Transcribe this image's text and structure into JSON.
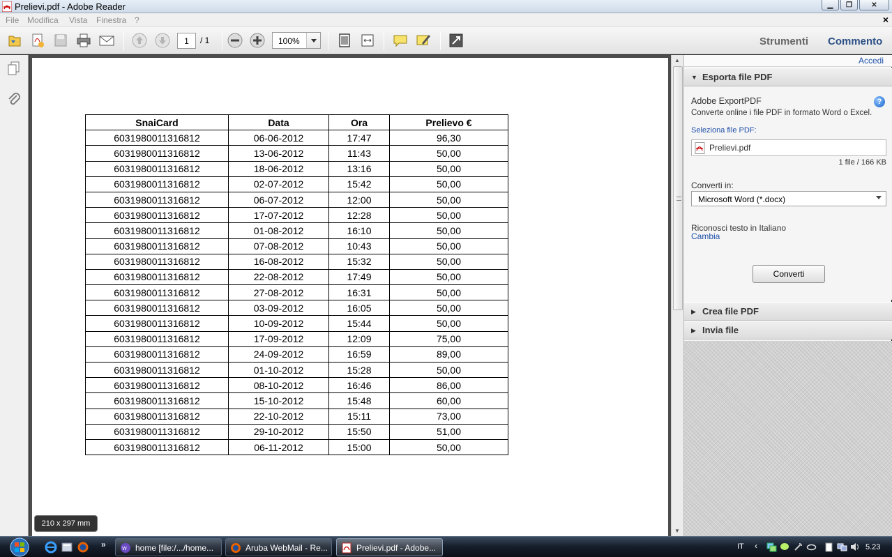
{
  "window": {
    "title": "Prelievi.pdf - Adobe Reader"
  },
  "menubar": {
    "items": [
      "File",
      "Modifica",
      "Vista",
      "Finestra",
      "?"
    ],
    "close_glyph": "×"
  },
  "toolbar": {
    "page_current": "1",
    "page_total": "/ 1",
    "zoom": "100%",
    "strumenti": "Strumenti",
    "commento": "Commento"
  },
  "document": {
    "columns": [
      "SnaiCard",
      "Data",
      "Ora",
      "Prelievo €"
    ],
    "rows": [
      [
        "6031980011316812",
        "06-06-2012",
        "17:47",
        "96,30"
      ],
      [
        "6031980011316812",
        "13-06-2012",
        "11:43",
        "50,00"
      ],
      [
        "6031980011316812",
        "18-06-2012",
        "13:16",
        "50,00"
      ],
      [
        "6031980011316812",
        "02-07-2012",
        "15:42",
        "50,00"
      ],
      [
        "6031980011316812",
        "06-07-2012",
        "12:00",
        "50,00"
      ],
      [
        "6031980011316812",
        "17-07-2012",
        "12:28",
        "50,00"
      ],
      [
        "6031980011316812",
        "01-08-2012",
        "16:10",
        "50,00"
      ],
      [
        "6031980011316812",
        "07-08-2012",
        "10:43",
        "50,00"
      ],
      [
        "6031980011316812",
        "16-08-2012",
        "15:32",
        "50,00"
      ],
      [
        "6031980011316812",
        "22-08-2012",
        "17:49",
        "50,00"
      ],
      [
        "6031980011316812",
        "27-08-2012",
        "16:31",
        "50,00"
      ],
      [
        "6031980011316812",
        "03-09-2012",
        "16:05",
        "50,00"
      ],
      [
        "6031980011316812",
        "10-09-2012",
        "15:44",
        "50,00"
      ],
      [
        "6031980011316812",
        "17-09-2012",
        "12:09",
        "75,00"
      ],
      [
        "6031980011316812",
        "24-09-2012",
        "16:59",
        "89,00"
      ],
      [
        "6031980011316812",
        "01-10-2012",
        "15:28",
        "50,00"
      ],
      [
        "6031980011316812",
        "08-10-2012",
        "16:46",
        "86,00"
      ],
      [
        "6031980011316812",
        "15-10-2012",
        "15:48",
        "60,00"
      ],
      [
        "6031980011316812",
        "22-10-2012",
        "15:11",
        "73,00"
      ],
      [
        "6031980011316812",
        "29-10-2012",
        "15:50",
        "51,00"
      ],
      [
        "6031980011316812",
        "06-11-2012",
        "15:00",
        "50,00"
      ]
    ],
    "page_size": "210 x 297 mm"
  },
  "right_pane": {
    "accedi": "Accedi",
    "export_section": {
      "header": "Esporta file PDF",
      "service_title": "Adobe ExportPDF",
      "description": "Converte online i file PDF in formato Word o Excel.",
      "select_label": "Seleziona file PDF:",
      "file_name": "Prelievi.pdf",
      "file_info": "1 file / 166 KB",
      "convert_label": "Converti in:",
      "convert_value": "Microsoft Word (*.docx)",
      "ocr_text": "Riconosci testo in Italiano",
      "ocr_change": "Cambia",
      "convert_button": "Converti"
    },
    "create_section": {
      "header": "Crea file PDF"
    },
    "send_section": {
      "header": "Invia file"
    }
  },
  "taskbar": {
    "tasks": [
      {
        "label": "home [file:/.../home...",
        "icon": "folder-app-icon"
      },
      {
        "label": "Aruba WebMail - Re...",
        "icon": "firefox-icon"
      },
      {
        "label": "Prelievi.pdf - Adobe...",
        "icon": "pdf-icon"
      }
    ],
    "language": "IT",
    "clock": "5.23"
  },
  "colors": {
    "link": "#1f4fa8",
    "heading_link": "#1f4fa8",
    "doc_bg": "#4c4c4c"
  }
}
